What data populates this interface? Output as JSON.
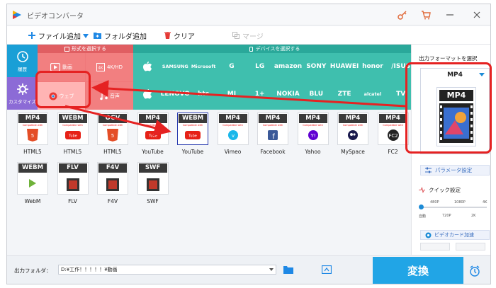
{
  "app": {
    "title": "ビデオコンバータ"
  },
  "toolbar": {
    "add_file": "ファイル追加",
    "add_folder": "フォルダ追加",
    "clear": "クリア",
    "merge": "マージ"
  },
  "left_nav": {
    "recent": "履歴",
    "custom": "カスタマイズ"
  },
  "categories": {
    "format_header": "形式を選択する",
    "device_header": "デバイスを選択する",
    "video": "動画",
    "hd": "4K/HD",
    "web": "ウェブ",
    "audio": "音声",
    "brands_row1": [
      "",
      "SAMSUNG",
      "Microsoft",
      "G",
      "LG",
      "amazon",
      "SONY",
      "HUAWEI",
      "honor",
      "/ISUS"
    ],
    "brands_row2": [
      "",
      "LENOVO",
      "htc",
      "MI",
      "1+",
      "NOKIA",
      "BLU",
      "ZTE",
      "alcatel",
      "TV"
    ]
  },
  "formats": [
    {
      "tag": "MP4",
      "sub": "Compatible with",
      "logo": "html5-icon",
      "caption": "HTML5"
    },
    {
      "tag": "WEBM",
      "sub": "Compatible with",
      "logo": "youtube-icon",
      "caption": "HTML5"
    },
    {
      "tag": "OGV",
      "sub": "Compatible with",
      "logo": "html5-icon",
      "caption": "HTML5"
    },
    {
      "tag": "MP4",
      "sub": "Compatible with",
      "logo": "youtube-icon",
      "caption": "YouTube"
    },
    {
      "tag": "WEBM",
      "sub": "Compatible with",
      "logo": "youtube-icon",
      "caption": "YouTube"
    },
    {
      "tag": "MP4",
      "sub": "Compatible with",
      "logo": "vimeo-icon",
      "caption": "Vimeo"
    },
    {
      "tag": "MP4",
      "sub": "Compatible with",
      "logo": "facebook-icon",
      "caption": "Facebook"
    },
    {
      "tag": "MP4",
      "sub": "Compatible with",
      "logo": "yahoo-icon",
      "caption": "Yahoo"
    },
    {
      "tag": "MP4",
      "sub": "Compatible with",
      "logo": "myspace-icon",
      "caption": "MySpace"
    },
    {
      "tag": "MP4",
      "sub": "Compatible with",
      "logo": "fc2-icon",
      "caption": "FC2"
    },
    {
      "tag": "WEBM",
      "sub": "",
      "logo": "webm-icon",
      "caption": "WebM"
    },
    {
      "tag": "FLV",
      "sub": "",
      "logo": "film-icon",
      "caption": "FLV"
    },
    {
      "tag": "F4V",
      "sub": "",
      "logo": "film-icon",
      "caption": "F4V"
    },
    {
      "tag": "SWF",
      "sub": "",
      "logo": "film-icon",
      "caption": "SWF"
    }
  ],
  "selected_format_index": 4,
  "output": {
    "label": "出力フォーマットを選択",
    "format": "MP4",
    "preview_tag": "MP4",
    "param_settings": "パラメータ設定",
    "quick_settings": "クイック設定",
    "res_top": [
      "480P",
      "1080P",
      "4K"
    ],
    "res_bottom": [
      "自動",
      "720P",
      "2K"
    ],
    "quality_level": 0,
    "gpu": "ビデオカード加速"
  },
  "bottom": {
    "folder_label": "出力フォルダ：",
    "folder_path": "D:¥工作！！！！！¥動画",
    "convert": "変換"
  },
  "colors": {
    "accent": "#21a5e6",
    "format_cat": "#f0787a",
    "format_cat_dark": "#d84f53",
    "device_cat": "#3fbfae",
    "device_cat_dark": "#2aa89a",
    "nav_recent": "#1a9fd6",
    "nav_custom": "#8c6bd6",
    "annotation": "#e52222"
  }
}
